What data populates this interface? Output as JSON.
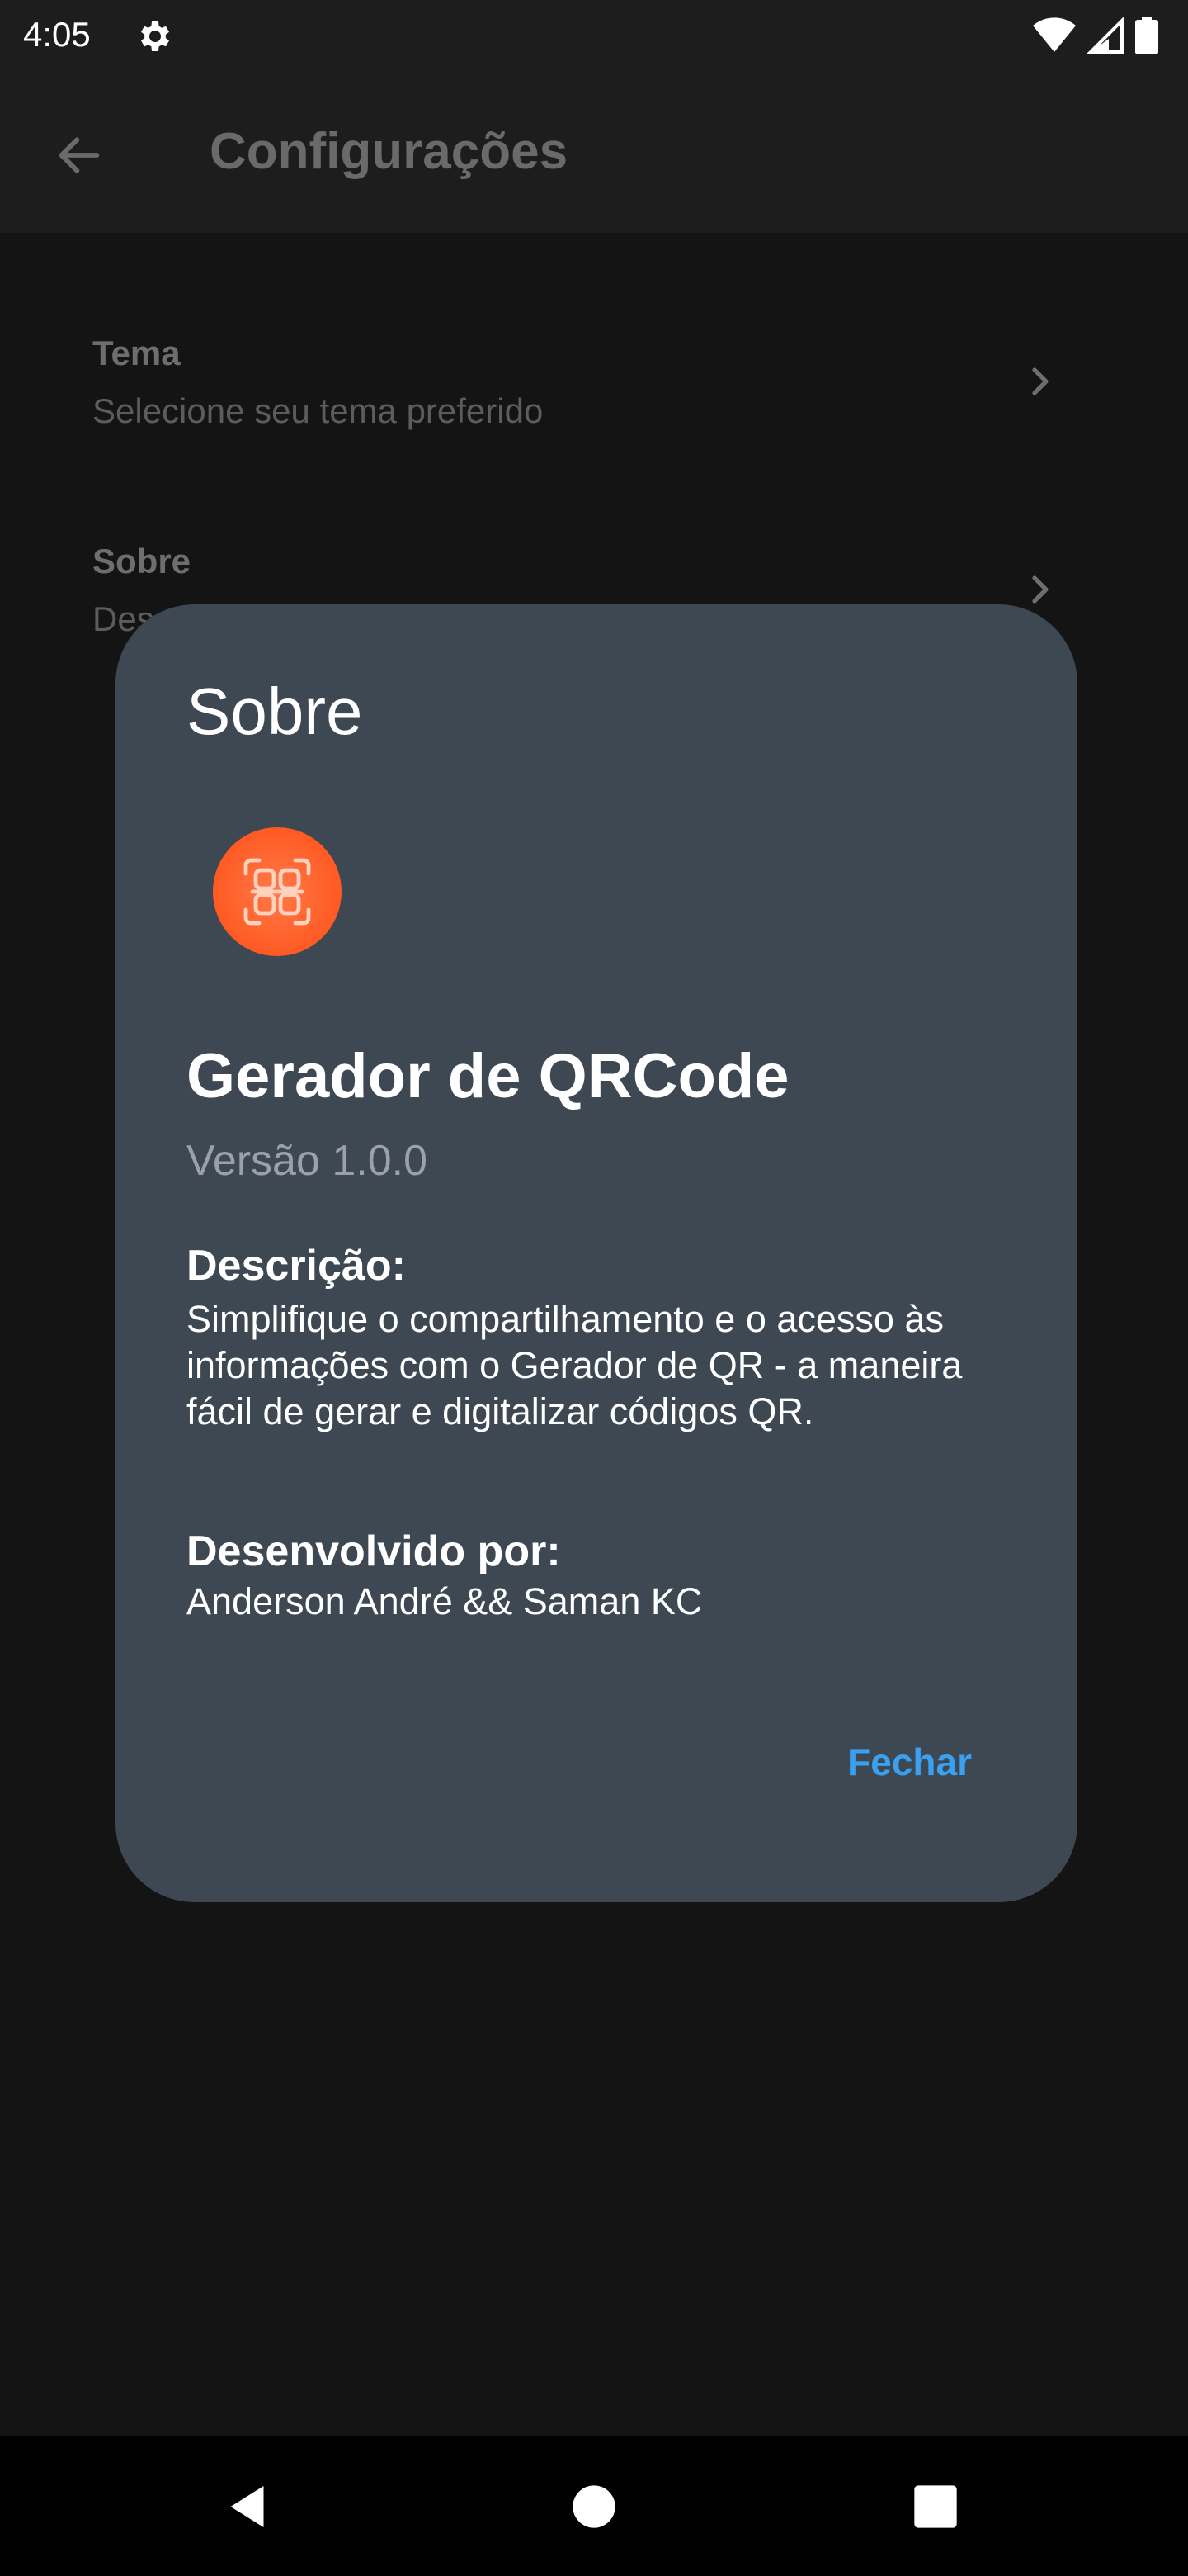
{
  "status_bar": {
    "time": "4:05",
    "icons": [
      "gear-icon",
      "wifi-icon",
      "signal-icon",
      "battery-icon"
    ]
  },
  "app_bar": {
    "title": "Configurações",
    "back_icon": "arrow-left-icon"
  },
  "settings": {
    "items": [
      {
        "title": "Tema",
        "subtitle": "Selecione seu tema preferido"
      },
      {
        "title": "Sobre",
        "subtitle": "Des"
      }
    ]
  },
  "dialog": {
    "title": "Sobre",
    "app_name": "Gerador de QRCode",
    "version": "Versão 1.0.0",
    "description_label": "Descrição:",
    "description": "Simplifique o compartilhamento e o acesso às informações com o Gerador de QR - a maneira fácil de gerar e digitalizar códigos QR.",
    "developer_label": "Desenvolvido por:",
    "developers": "Anderson André && Saman KC",
    "close_label": "Fechar",
    "logo_icon": "qr-scan-logo-icon"
  },
  "colors": {
    "background": "#141414",
    "bar": "#1d1d1d",
    "dialog": "#3d4852",
    "accent": "#3aa0f0",
    "logo": "#ff5a23"
  }
}
